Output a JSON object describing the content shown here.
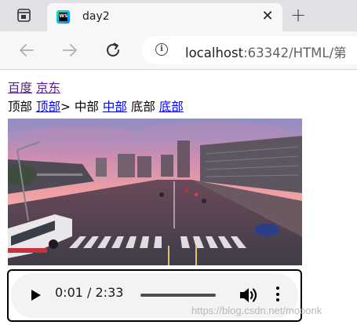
{
  "browser": {
    "tab_title": "day2",
    "tab_favicon_text": "WS",
    "close_symbol": "✕",
    "new_tab_symbol": "+",
    "address_host": "localhost",
    "address_rest": ":63342/HTML/第"
  },
  "page": {
    "links_row1": [
      "百度",
      "京东"
    ],
    "row2": {
      "label_top": "顶部",
      "link_top": "顶部",
      "arrow": ">",
      "label_middle": "中部",
      "link_middle": "中部",
      "label_bottom": "底部",
      "link_bottom": "底部"
    },
    "image_alt": "City street at sunset"
  },
  "audio": {
    "time": "0:01 / 2:33",
    "progress": 0.0065
  },
  "watermark": "https://blog.csdn.net/mooonk",
  "colors": {
    "visited_link": "#551a8b",
    "link": "#0000ee",
    "tab_bar": "#dfe1e5",
    "toolbar": "#f7f7f7",
    "player_bg": "#f1f3f4"
  }
}
